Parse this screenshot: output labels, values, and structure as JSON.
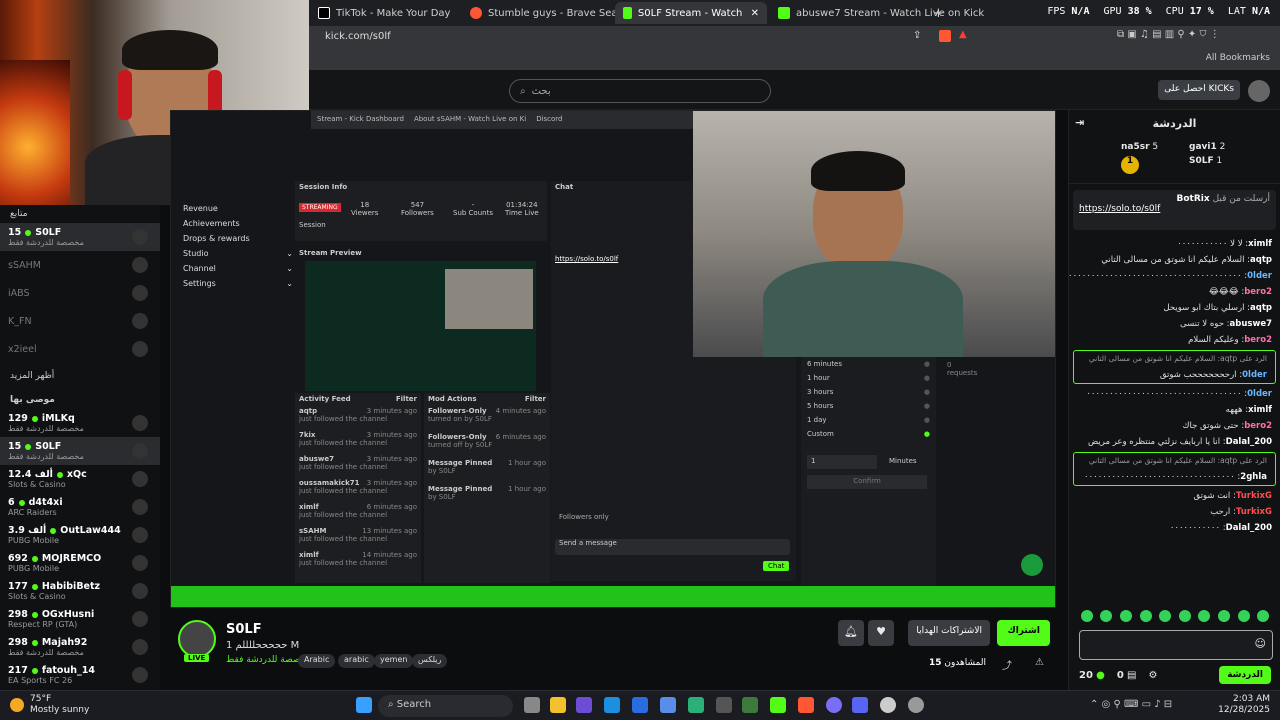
{
  "browser": {
    "tabs": [
      {
        "label": "TikTok - Make Your Day",
        "color": "#ffffff"
      },
      {
        "label": "Stumble guys - Brave Search",
        "color": "#ff5733"
      },
      {
        "label": "S0LF Stream - Watch Live on",
        "color": "#53fc18"
      },
      {
        "label": "abuswe7 Stream - Watch Live on Kick",
        "color": "#53fc18"
      }
    ],
    "new_tab": "+",
    "url": "kick.com/s0lf",
    "bookmarks": "All Bookmarks",
    "perf": {
      "fps_label": "FPS",
      "fps": "N/A",
      "gpu_label": "GPU",
      "gpu": "38 %",
      "cpu_label": "CPU",
      "cpu": "17 %",
      "lat_label": "LAT",
      "lat": "N/A"
    }
  },
  "kick": {
    "search_placeholder": "بحث",
    "get_kicks": "احصل على KICKs"
  },
  "sidebar": {
    "following_label": "متابع",
    "following": [
      {
        "name": "S0LF",
        "cat": "مخصصة للدردشة فقط",
        "count": "15",
        "live": true,
        "selected": true
      },
      {
        "name": "sSAHM",
        "live": false
      },
      {
        "name": "iABS",
        "live": false
      },
      {
        "name": "K_FN",
        "live": false
      },
      {
        "name": "x2ieel",
        "live": false
      }
    ],
    "show_more": "أظهر المزيد",
    "recommended_label": "موصى بها",
    "recommended": [
      {
        "count": "129",
        "name": "iMLKq",
        "cat": "مخصصة للدردشة فقط"
      },
      {
        "count": "15",
        "name": "S0LF",
        "cat": "مخصصة للدردشة فقط",
        "selected": true
      },
      {
        "count": "12.4 ألف",
        "name": "xQc",
        "cat": "Slots & Casino"
      },
      {
        "count": "6",
        "name": "d4t4xi",
        "cat": "ARC Raiders"
      },
      {
        "count": "3.9 ألف",
        "name": "OutLaw444",
        "cat": "PUBG Mobile"
      },
      {
        "count": "692",
        "name": "MOJREMCO",
        "cat": "PUBG Mobile"
      },
      {
        "count": "177",
        "name": "HabibiBetz",
        "cat": "Slots & Casino"
      },
      {
        "count": "298",
        "name": "OGxHusni",
        "cat": "Respect RP (GTA)"
      },
      {
        "count": "298",
        "name": "Majah92",
        "cat": "مخصصة للدردشة فقط"
      },
      {
        "count": "217",
        "name": "fatouh_14",
        "cat": "EA Sports FC 26"
      }
    ]
  },
  "video": {
    "inner_tabs": [
      "Stream - Kick Dashboard",
      "About sSAHM - Watch Live on Ki",
      "Discord"
    ],
    "session": {
      "title": "Session Info",
      "badge": "STREAMING",
      "viewers": "18",
      "viewers_label": "Viewers",
      "followers": "547",
      "followers_label": "Followers",
      "subs": "-",
      "subs_label": "Sub Counts",
      "time": "01:34:24",
      "time_label": "Time Live",
      "session_label": "Session"
    },
    "nav": [
      "Revenue",
      "Achievements",
      "Drops & rewards",
      "Studio",
      "Channel",
      "Settings"
    ],
    "preview_label": "Stream Preview",
    "activity_title": "Activity Feed",
    "activity_filter": "Filter",
    "activity": [
      {
        "name": "aqtp",
        "desc": "just followed the channel",
        "time": "3 minutes ago"
      },
      {
        "name": "7kix",
        "desc": "just followed the channel",
        "time": "3 minutes ago"
      },
      {
        "name": "abuswe7",
        "desc": "just followed the channel",
        "time": "3 minutes ago"
      },
      {
        "name": "oussamakick71",
        "desc": "just followed the channel",
        "time": "3 minutes ago"
      },
      {
        "name": "ximlf",
        "desc": "just followed the channel",
        "time": "6 minutes ago"
      },
      {
        "name": "sSAHM",
        "desc": "just followed the channel",
        "time": "13 minutes ago"
      },
      {
        "name": "ximlf",
        "desc": "just followed the channel",
        "time": "14 minutes ago"
      }
    ],
    "mod_title": "Mod Actions",
    "mod_filter": "Filter",
    "mod": [
      {
        "name": "Followers-Only",
        "desc": "turned on by S0LF",
        "time": "4 minutes ago"
      },
      {
        "name": "Followers-Only",
        "desc": "turned off by S0LF",
        "time": "6 minutes ago"
      },
      {
        "name": "Message Pinned",
        "desc": "by S0LF",
        "time": "1 hour ago"
      },
      {
        "name": "Message Pinned",
        "desc": "by S0LF",
        "time": "1 hour ago"
      }
    ],
    "chat_title": "Chat",
    "chat_link": "https://solo.to/s0lf",
    "chat_input": "Send a message",
    "chat_button": "Chat",
    "followers_only": "Followers only",
    "durations": [
      "6 minutes",
      "1 hour",
      "3 hours",
      "5 hours",
      "1 day",
      "Custom"
    ],
    "custom_value": "1",
    "custom_unit": "Minutes",
    "confirm": "Confirm",
    "requests": "0 requests"
  },
  "stream": {
    "name": "S0LF",
    "title": "حححححللللم 1 M",
    "category": "مخصصة للدردشة فقط",
    "live_badge": "LIVE",
    "tags": [
      "Arabic",
      "arabic",
      "yemen",
      "ريلكس"
    ],
    "subscribe": "اشتراك",
    "gift": "الاشتراكات الهدايا",
    "viewers_label": "المشاهدون",
    "viewers": "15"
  },
  "chat": {
    "title": "الدردشة",
    "leaders": [
      {
        "rank": "2",
        "name": "gavi1",
        "value": "2"
      },
      {
        "rank": "1",
        "name": "na5sr",
        "value": "5"
      },
      {
        "rank": "",
        "name": "S0LF",
        "value": "1"
      }
    ],
    "pinned_by": "BotRix",
    "pinned_label": "أرسلت من قبل",
    "pinned_link": "https://solo.to/s0lf",
    "messages": [
      {
        "user": "ximlf",
        "text": "لا لا ٠٠٠٠٠٠٠٠٠٠٠",
        "color": "u-white"
      },
      {
        "user": "aqtp",
        "text": "السلام عليكم انا شوتق من مسالى التاني",
        "color": "u-white"
      },
      {
        "user": "0lder",
        "text": "٠٠٠٠٠٠٠٠٠٠٠٠٠٠٠٠٠٠٠٠٠٠٠٠٠٠٠٠٠٠٠٠٠٠٠٠٠٠٠٠٠",
        "color": "u-blue"
      },
      {
        "user": "bero2",
        "text": "😂😂😂",
        "color": "u-pink"
      },
      {
        "user": "aqtp",
        "text": "ارسلي بتاك ابو سويحل",
        "color": "u-white"
      },
      {
        "user": "abuswe7",
        "text": "حوه لا تنسى",
        "color": "u-white"
      },
      {
        "user": "bero2",
        "text": "وعليكم السلام",
        "color": "u-pink"
      },
      {
        "user": "0lder",
        "text": "ارحححححححب شوتق",
        "color": "u-blue",
        "reply": "الرد على aqtp: السلام عليكم انا شوتق من مسالى التاني"
      },
      {
        "user": "0lder",
        "text": "٠٠٠٠٠٠٠٠٠٠٠٠٠٠٠٠٠٠٠٠٠٠٠٠٠٠٠٠٠٠٠٠٠٠",
        "color": "u-blue"
      },
      {
        "user": "ximlf",
        "text": "هههه",
        "color": "u-white"
      },
      {
        "user": "bero2",
        "text": "حتى شوتق جاك",
        "color": "u-pink"
      },
      {
        "user": "Dalal_200",
        "text": "انا يا اربايف نزلتي منتظره وعر مريض",
        "color": "u-white"
      },
      {
        "user": "2ghla",
        "text": "٠٠٠٠٠٠٠٠٠٠٠٠٠٠٠٠٠٠٠٠٠٠٠٠٠٠٠٠٠٠٠٠٠",
        "color": "u-white",
        "reply": "الرد على aqtp: السلام عليكم انا شوتق من مسالى التاني"
      },
      {
        "user": "TurkixG",
        "text": "انت شوتق",
        "color": "u-red"
      },
      {
        "user": "TurkixG",
        "text": "ارحب",
        "color": "u-red"
      },
      {
        "user": "Dalal_200",
        "text": "٠٠٠٠٠٠٠٠٠٠٠",
        "color": "u-white"
      }
    ],
    "kicks_count": "20",
    "points_count": "0",
    "send_label": "الدردشة"
  },
  "taskbar": {
    "temp": "75°F",
    "weather": "Mostly sunny",
    "search": "Search",
    "time": "2:03 AM",
    "date": "12/28/2025"
  }
}
